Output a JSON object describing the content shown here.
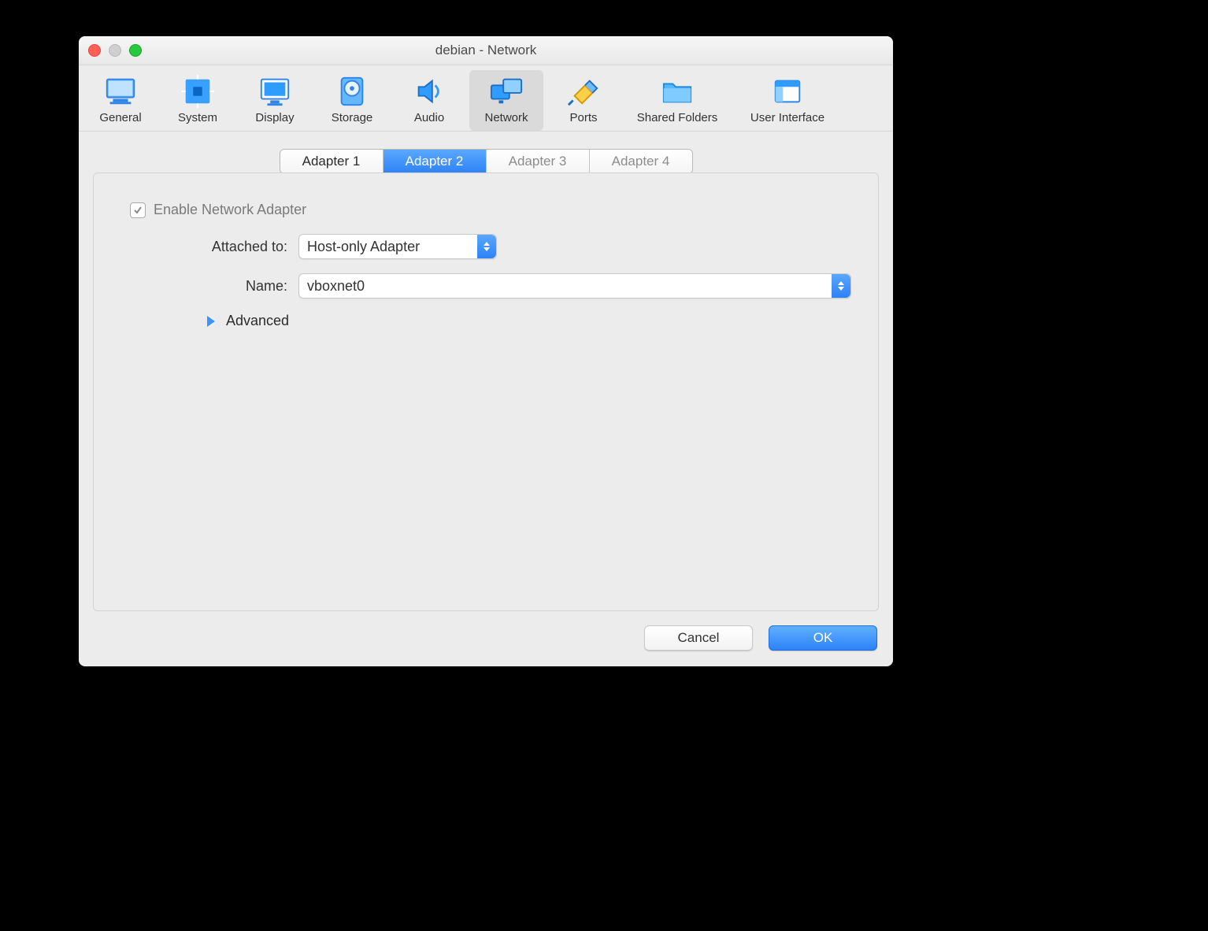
{
  "window": {
    "title": "debian - Network"
  },
  "toolbar": {
    "items": [
      {
        "label": "General"
      },
      {
        "label": "System"
      },
      {
        "label": "Display"
      },
      {
        "label": "Storage"
      },
      {
        "label": "Audio"
      },
      {
        "label": "Network"
      },
      {
        "label": "Ports"
      },
      {
        "label": "Shared Folders"
      },
      {
        "label": "User Interface"
      }
    ]
  },
  "tabs": {
    "items": [
      {
        "label": "Adapter 1"
      },
      {
        "label": "Adapter 2"
      },
      {
        "label": "Adapter 3"
      },
      {
        "label": "Adapter 4"
      }
    ]
  },
  "form": {
    "enable_label": "Enable Network Adapter",
    "attached_label": "Attached to:",
    "attached_value": "Host-only Adapter",
    "name_label": "Name:",
    "name_value": "vboxnet0",
    "advanced_label": "Advanced"
  },
  "footer": {
    "cancel": "Cancel",
    "ok": "OK"
  }
}
